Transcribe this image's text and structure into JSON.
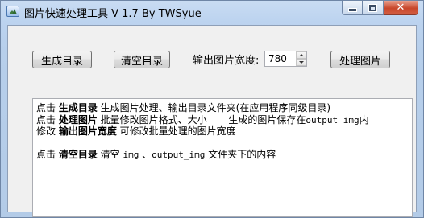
{
  "window": {
    "title": "图片快速处理工具 V 1.7 By TWSyue",
    "minimize_label": "",
    "maximize_label": "",
    "close_label": "✕"
  },
  "toolbar": {
    "generate_dir_label": "生成目录",
    "clear_dir_label": "清空目录",
    "width_label": "输出图片宽度:",
    "width_value": "780",
    "process_label": "处理图片"
  },
  "info": {
    "line1": {
      "prefix": "点击 ",
      "keyword": "生成目录",
      "rest": " 生成图片处理、输出目录文件夹(在应用程序同级目录)"
    },
    "line2": {
      "prefix": "点击 ",
      "keyword": "处理图片",
      "rest": " 批量修改图片格式、大小       生成的图片保存在",
      "mono": "output_img",
      "suffix": "内"
    },
    "line3": {
      "prefix": "修改 ",
      "keyword": "输出图片宽度",
      "rest": " 可修改批量处理的图片宽度"
    },
    "line4": {
      "prefix": "点击 ",
      "keyword": "清空目录",
      "rest": " 清空 ",
      "mono1": "img",
      "mid": " 、",
      "mono2": "output_img",
      "suffix": " 文件夹下的内容"
    }
  }
}
